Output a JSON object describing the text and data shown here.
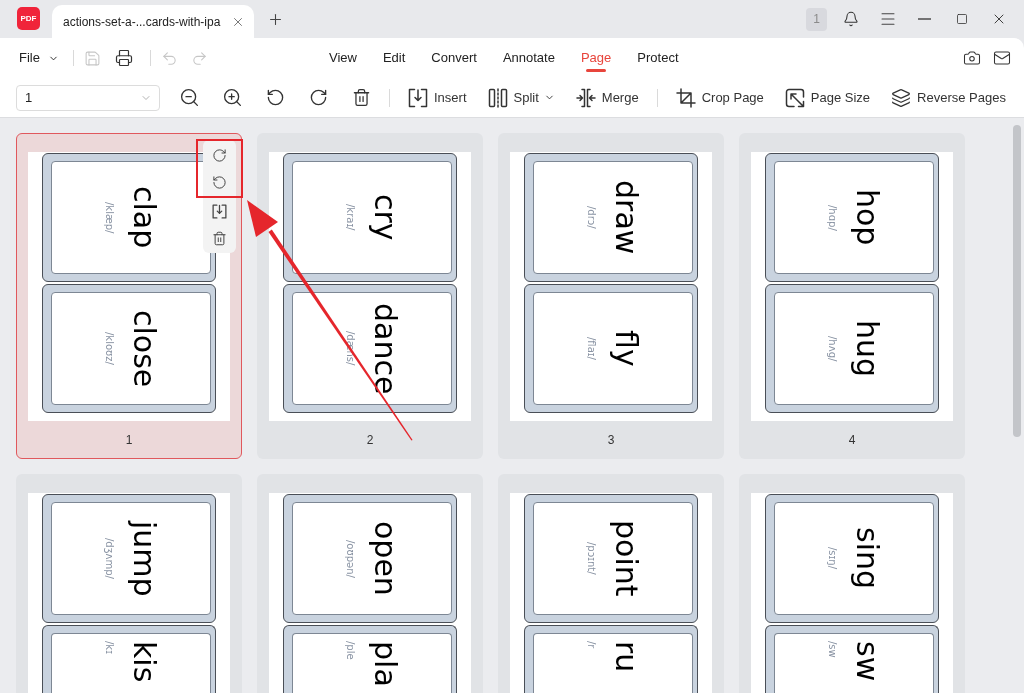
{
  "app": {
    "logo_text": "PDF",
    "document_tab": {
      "title": "actions-set-a-...cards-with-ipa"
    },
    "notification_count": "1"
  },
  "menu_bar": {
    "file_menu": "File",
    "quick_actions": [
      {
        "kind": "save",
        "disabled": true
      },
      {
        "kind": "print",
        "disabled": false
      },
      {
        "kind": "undo",
        "disabled": true
      },
      {
        "kind": "redo",
        "disabled": true
      }
    ],
    "tabs": [
      {
        "label": "View",
        "selected": false
      },
      {
        "label": "Edit",
        "selected": false
      },
      {
        "label": "Convert",
        "selected": false
      },
      {
        "label": "Annotate",
        "selected": false
      },
      {
        "label": "Page",
        "selected": true
      },
      {
        "label": "Protect",
        "selected": false
      }
    ]
  },
  "toolbar": {
    "page_select": {
      "value": "1"
    },
    "actions": [
      {
        "kind": "insert",
        "label": "Insert",
        "dropdown": false
      },
      {
        "kind": "split",
        "label": "Split",
        "dropdown": true
      },
      {
        "kind": "merge",
        "label": "Merge",
        "dropdown": false
      },
      {
        "kind": "crop",
        "label": "Crop Page",
        "dropdown": false
      },
      {
        "kind": "page_size",
        "label": "Page Size",
        "dropdown": false
      },
      {
        "kind": "reverse",
        "label": "Reverse Pages",
        "dropdown": false
      }
    ]
  },
  "pages": [
    {
      "number": "1",
      "selected": true,
      "hovered": true,
      "cards": [
        {
          "word": "clap",
          "ipa": "/klæp/"
        },
        {
          "word": "close",
          "ipa": "/kloʊz/"
        }
      ]
    },
    {
      "number": "2",
      "selected": false,
      "hovered": false,
      "cards": [
        {
          "word": "cry",
          "ipa": "/kraɪ/"
        },
        {
          "word": "dance",
          "ipa": "/dæns/"
        }
      ]
    },
    {
      "number": "3",
      "selected": false,
      "hovered": false,
      "cards": [
        {
          "word": "draw",
          "ipa": "/drɔ/"
        },
        {
          "word": "fly",
          "ipa": "/flaɪ/"
        }
      ]
    },
    {
      "number": "4",
      "selected": false,
      "hovered": false,
      "cards": [
        {
          "word": "hop",
          "ipa": "/hɑp/"
        },
        {
          "word": "hug",
          "ipa": "/hʌg/"
        }
      ]
    },
    {
      "selected": false,
      "hovered": false,
      "cards": [
        {
          "word": "jump",
          "ipa": "/dʒʌmp/"
        },
        {
          "word": "kis",
          "ipa": "/kɪ"
        }
      ]
    },
    {
      "selected": false,
      "hovered": false,
      "cards": [
        {
          "word": "open",
          "ipa": "/oʊpən/"
        },
        {
          "word": "pla",
          "ipa": "/ple"
        }
      ]
    },
    {
      "selected": false,
      "hovered": false,
      "cards": [
        {
          "word": "point",
          "ipa": "/pɔɪnt/"
        },
        {
          "word": "ru",
          "ipa": "/r"
        }
      ]
    },
    {
      "selected": false,
      "hovered": false,
      "cards": [
        {
          "word": "sing",
          "ipa": "/sɪŋ/"
        },
        {
          "word": "sw",
          "ipa": "/sw"
        }
      ]
    }
  ]
}
